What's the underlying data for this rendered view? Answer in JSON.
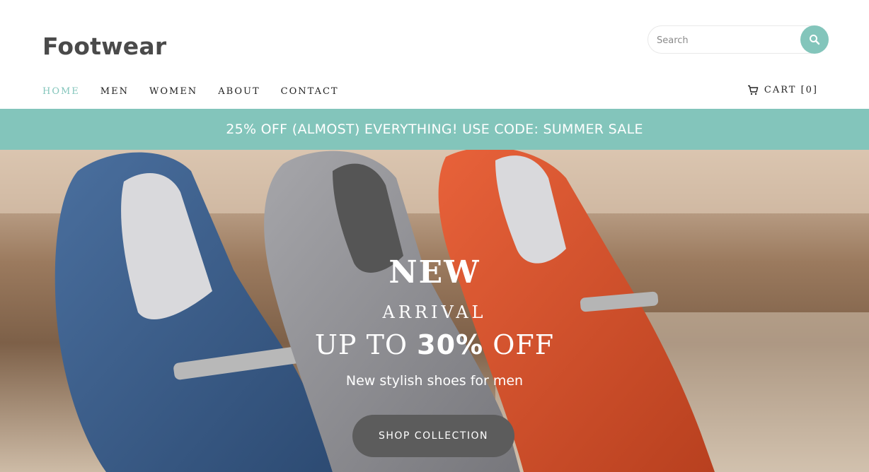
{
  "header": {
    "logo": "Footwear",
    "search_placeholder": "Search",
    "search_icon": "search-icon"
  },
  "nav": {
    "items": [
      "HOME",
      "MEN",
      "WOMEN",
      "ABOUT",
      "CONTACT"
    ],
    "active": "HOME",
    "cart_label": "CART [0]",
    "cart_icon": "cart-icon"
  },
  "promo": {
    "text": "25% OFF (ALMOST) EVERYTHING! USE CODE: SUMMER SALE"
  },
  "hero": {
    "title": "NEW",
    "subtitle": "ARRIVAL",
    "offer_prefix": "UP TO ",
    "offer_percent": "30%",
    "offer_suffix": " OFF",
    "tagline": "New stylish shoes for men",
    "button_label": "SHOP COLLECTION"
  },
  "colors": {
    "accent": "#83c5bb",
    "button": "#5c5c5c",
    "shoe_blue": "#3c5f8c",
    "shoe_grey": "#8e8e92",
    "shoe_red": "#d9502a"
  }
}
